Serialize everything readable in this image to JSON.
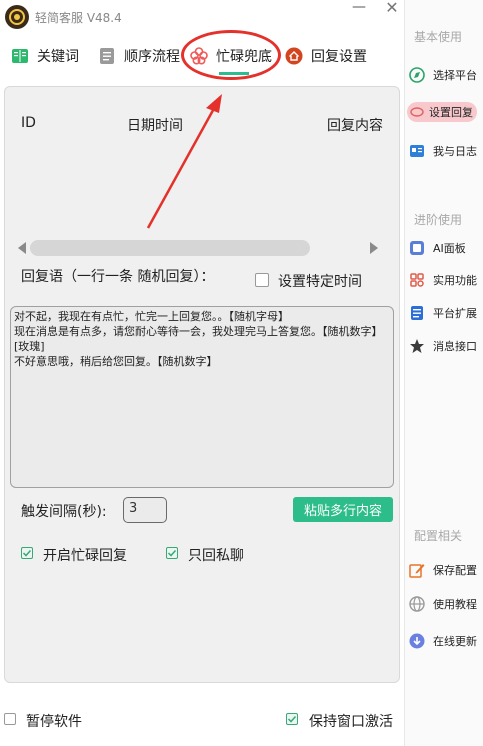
{
  "app": {
    "title": "轻简客服  V48.4"
  },
  "window": {
    "minimize_label": "—",
    "close_label": "✕"
  },
  "tabs": [
    {
      "label": "关键词",
      "icon": "book-icon"
    },
    {
      "label": "顺序流程",
      "icon": "document-icon"
    },
    {
      "label": "忙碌兜底",
      "icon": "flower-icon",
      "active": true
    },
    {
      "label": "回复设置",
      "icon": "home-icon"
    }
  ],
  "table": {
    "columns": [
      "ID",
      "日期时间",
      "回复内容"
    ]
  },
  "reply": {
    "label": "回复语（一行一条 随机回复）：",
    "specific_time_label": "设置特定时间",
    "lines": [
      "对不起，我现在有点忙，忙完一上回复您。。【随机字母】",
      "现在消息是有点多，请您耐心等待一会，我处理完马上答复您。【随机数字】",
      "[玫瑰]",
      "不好意思哦，稍后给您回复。【随机数字】"
    ]
  },
  "trigger": {
    "label": "触发间隔(秒):",
    "value": "3",
    "paste_button": "粘贴多行内容"
  },
  "options": {
    "enable_busy_reply": "开启忙碌回复",
    "private_only": "只回私聊"
  },
  "footer": {
    "pause_label": "暂停软件",
    "keep_active_label": "保持窗口激活"
  },
  "sidebar": {
    "sections": [
      {
        "title": "基本使用",
        "items": [
          {
            "label": "选择平台",
            "icon": "platform-icon"
          },
          {
            "label": "设置回复",
            "icon": "reply-settings-icon",
            "active": true
          },
          {
            "label": "我与日志",
            "icon": "log-icon"
          }
        ]
      },
      {
        "title": "进阶使用",
        "items": [
          {
            "label": "AI面板",
            "icon": "ai-icon"
          },
          {
            "label": "实用功能",
            "icon": "tools-icon"
          },
          {
            "label": "平台扩展",
            "icon": "extension-icon"
          },
          {
            "label": "消息接口",
            "icon": "star-icon"
          }
        ]
      },
      {
        "title": "配置相关",
        "items": [
          {
            "label": "保存配置",
            "icon": "edit-icon"
          },
          {
            "label": "使用教程",
            "icon": "globe-icon"
          },
          {
            "label": "在线更新",
            "icon": "update-icon"
          }
        ]
      }
    ]
  },
  "colors": {
    "accent": "#2dbd8a",
    "highlight": "#e4312b",
    "active_pill": "#f7c9cc"
  }
}
